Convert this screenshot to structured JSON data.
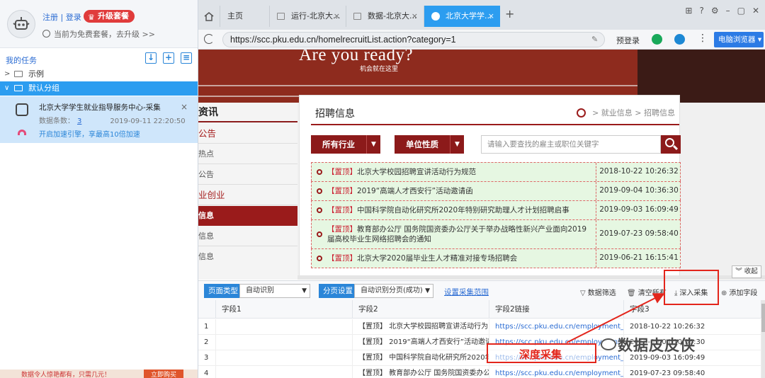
{
  "left_panel": {
    "auth": {
      "register": "注册",
      "sep": "|",
      "login": "登录"
    },
    "upgrade_label": "升级套餐",
    "plan_note": "当前为免费套餐，去升级 >>",
    "task_section_title": "我的任务",
    "tree": [
      {
        "label": "示例",
        "expanded": false
      },
      {
        "label": "默认分组",
        "expanded": true
      }
    ],
    "task": {
      "name": "北京大学学生就业指导服务中心-采集",
      "count_label": "数据条数：",
      "count_value": "3",
      "timestamp": "2019-09-11 22:20:50",
      "speed_link": "开启加速引擎，享最高10倍加速"
    },
    "footer_text": "数据令人惊艳都有，只需几元！",
    "footer_button": "立即购买"
  },
  "browser": {
    "tabs": [
      {
        "label": "主页",
        "active": false,
        "closable": false
      },
      {
        "label": "运行-北京大...",
        "active": false,
        "closable": true
      },
      {
        "label": "数据-北京大...",
        "active": false,
        "closable": true
      },
      {
        "label": "北京大学学...",
        "active": true,
        "closable": true
      }
    ],
    "url": "https://scc.pku.edu.cn/homelrecruitList.action?category=1",
    "predict_login": "预登录",
    "browser_mode": "电脑浏览器"
  },
  "page": {
    "hero_title": "Are you ready?",
    "hero_sub": "机会就在这里",
    "left_nav": [
      {
        "label": "资讯",
        "style": "hd"
      },
      {
        "label": "公告",
        "style": "red"
      },
      {
        "label": "热点",
        "style": "plain"
      },
      {
        "label": "公告",
        "style": "plain"
      },
      {
        "label": "业创业",
        "style": "red"
      },
      {
        "label": "信息",
        "style": "sel"
      },
      {
        "label": "信息",
        "style": "plain"
      },
      {
        "label": "信息",
        "style": "plain"
      }
    ],
    "card_title": "招聘信息",
    "breadcrumb": [
      ">",
      "就业信息",
      ">",
      "招聘信息"
    ],
    "filter_industry": "所有行业",
    "filter_unit": "单位性质",
    "search_placeholder": "请输入要查找的雇主或职位关键字",
    "jobs": [
      {
        "tag": "【置顶】",
        "title": "北京大学校园招聘宣讲活动行为规范",
        "date": "2018-10-22 10:26:32"
      },
      {
        "tag": "【置顶】",
        "title": "2019“高端人才西安行”活动邀请函",
        "date": "2019-09-04 10:36:30"
      },
      {
        "tag": "【置顶】",
        "title": "中国科学院自动化研究所2020年特别研究助理人才计划招聘启事",
        "date": "2019-09-03 16:09:49"
      },
      {
        "tag": "【置顶】",
        "title": "教育部办公厅 国务院国资委办公厅关于举办战略性新兴产业面向2019届高校毕业生网络招聘会的通知",
        "date": "2019-07-23 09:58:40"
      },
      {
        "tag": "【置顶】",
        "title": "北京大学2020届毕业生人才精准对接专场招聘会",
        "date": "2019-06-21 16:15:41"
      }
    ],
    "collapse_label": "收起"
  },
  "toolbar": {
    "page_type_label": "页面类型",
    "page_type_value": "自动识别",
    "paging_label": "分页设置",
    "paging_value": "自动识别分页(成功)",
    "set_range_link": "设置采集范围",
    "filter": "数据筛选",
    "clear": "清空所有",
    "deep": "深入采集",
    "add_field": "添加字段"
  },
  "grid": {
    "headers": [
      "",
      "字段1",
      "字段2",
      "字段2链接",
      "字段3"
    ],
    "rows": [
      [
        "1",
        "",
        "【置顶】 北京大学校园招聘宣讲活动行为...",
        "https://scc.pku.edu.cn/employment_ff808...",
        "2018-10-22 10:26:32"
      ],
      [
        "2",
        "",
        "【置顶】 2019“高端人才西安行”活动邀请函",
        "https://scc.pku.edu.cn/employment_ff808...",
        "2019-09-04 10:36:30"
      ],
      [
        "3",
        "",
        "【置顶】 中国科学院自动化研究所2020年...",
        "https://scc.pku.edu.cn/employment_ff808...",
        "2019-09-03 16:09:49"
      ],
      [
        "4",
        "",
        "【置顶】 教育部办公厅 国务院国资委办公...",
        "https://scc.pku.edu.cn/employment_ff808...",
        "2019-07-23 09:58:40"
      ]
    ]
  },
  "annotation": {
    "label": "深度采集",
    "watermark": "数据皮皮侠",
    "color": "#e3251b"
  }
}
